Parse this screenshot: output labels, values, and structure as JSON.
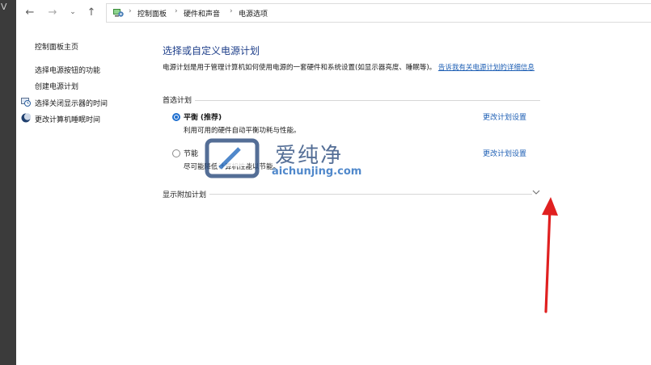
{
  "left_strip_letter": "V",
  "nav": {
    "back_icon": "arrow-left-icon",
    "forward_icon": "arrow-right-icon",
    "recent_icon": "chevron-down-icon",
    "up_icon": "arrow-up-icon"
  },
  "breadcrumb": {
    "icon": "control-panel-icon",
    "items": [
      "控制面板",
      "硬件和声音",
      "电源选项"
    ]
  },
  "sidebar": {
    "home": "控制面板主页",
    "links": [
      {
        "label": "选择电源按钮的功能"
      },
      {
        "label": "创建电源计划"
      },
      {
        "label": "选择关闭显示器的时间",
        "icon": "monitor-clock-icon"
      },
      {
        "label": "更改计算机睡眠时间",
        "icon": "moon-icon"
      }
    ]
  },
  "main": {
    "title": "选择或自定义电源计划",
    "description": "电源计划是用于管理计算机如何使用电源的一套硬件和系统设置(如显示器亮度、睡眠等)。",
    "tell_me_link": "告诉我有关电源计划的详细信息",
    "preferred_label": "首选计划",
    "plans": [
      {
        "name": "平衡",
        "tag": "(推荐)",
        "desc": "利用可用的硬件自动平衡功耗与性能。",
        "link": "更改计划设置",
        "selected": true
      },
      {
        "name": "节能",
        "desc": "尽可能降低计算机性能以节能。",
        "link": "更改计划设置",
        "selected": false
      }
    ],
    "additional_label": "显示附加计划",
    "expand_icon": "chevron-down-icon"
  },
  "watermark": {
    "text": "爱纯净",
    "url": "aichunjing.com",
    "icon": "aichunjing-logo-icon"
  },
  "annotation": {
    "arrow_icon": "red-arrow-icon",
    "color": "#e02020"
  },
  "colors": {
    "link": "#1e5fb4",
    "title": "#1e3f8a",
    "radio_selected": "#1e6fd0"
  }
}
